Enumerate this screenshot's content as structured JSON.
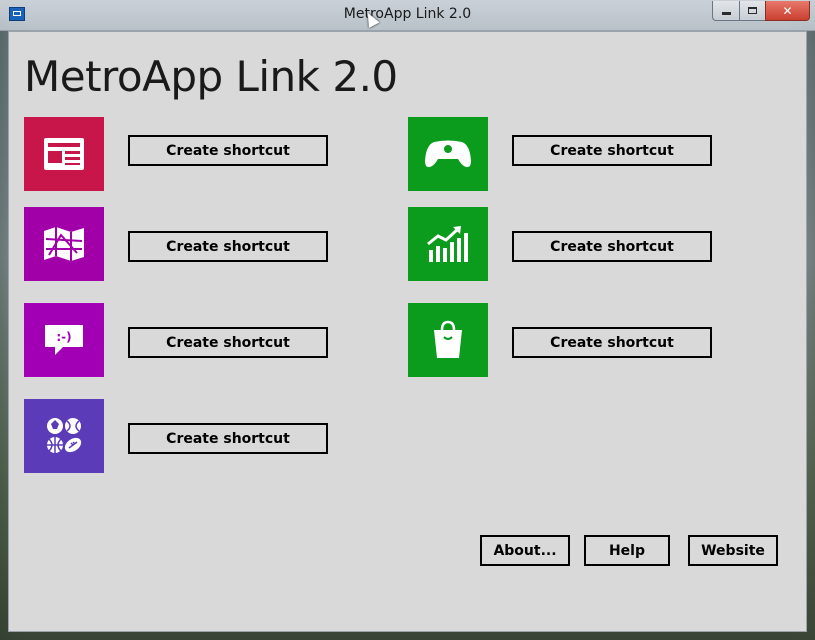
{
  "window": {
    "title": "MetroApp Link 2.0",
    "controls": [
      "minimize",
      "maximize",
      "close"
    ]
  },
  "header": {
    "title": "MetroApp Link 2.0"
  },
  "apps": [
    {
      "icon": "news-icon",
      "color": "#c8164a",
      "button_label": "Create shortcut"
    },
    {
      "icon": "maps-icon",
      "color": "#a100a8",
      "button_label": "Create shortcut"
    },
    {
      "icon": "messaging-icon",
      "color": "#a100b4",
      "button_label": "Create shortcut"
    },
    {
      "icon": "sports-icon",
      "color": "#5b3bb8",
      "button_label": "Create shortcut"
    },
    {
      "icon": "games-controller-icon",
      "color": "#0b9b1d",
      "button_label": "Create shortcut"
    },
    {
      "icon": "finance-chart-icon",
      "color": "#0b9b1d",
      "button_label": "Create shortcut"
    },
    {
      "icon": "store-bag-icon",
      "color": "#0b9b1d",
      "button_label": "Create shortcut"
    }
  ],
  "footer": {
    "about_label": "About...",
    "help_label": "Help",
    "website_label": "Website"
  }
}
